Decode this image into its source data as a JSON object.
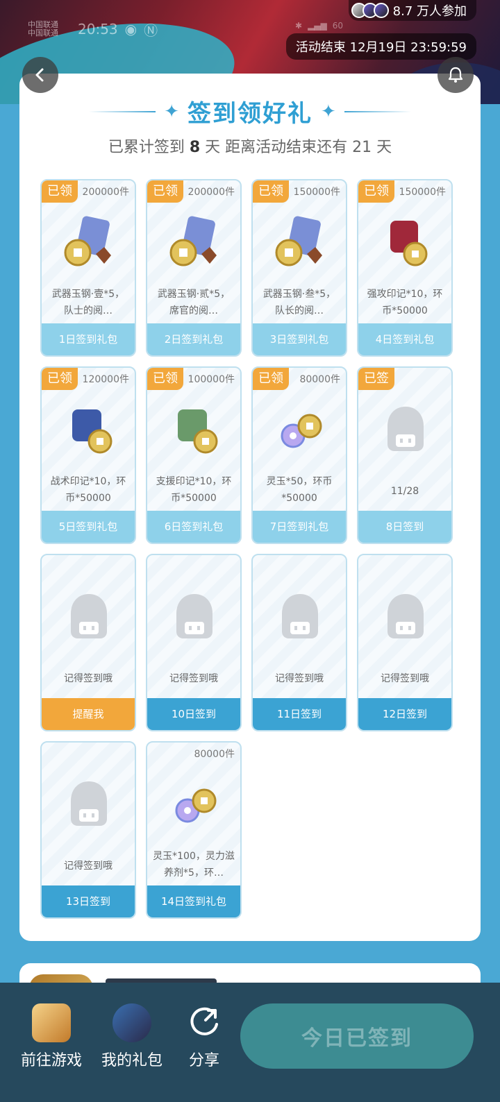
{
  "header": {
    "status_time": "20:53",
    "status_carrier_line1": "中国联通",
    "status_carrier_line2": "中国联通",
    "status_battery": "60",
    "participants_text": "8.7 万人参加",
    "end_time_text": "活动结束 12月19日 23:59:59"
  },
  "main": {
    "title": "签到领好礼",
    "subtitle_prefix": "已累计签到 ",
    "subtitle_days": "8",
    "subtitle_suffix": " 天  距离活动结束还有 21 天",
    "cells": [
      {
        "badge": "已领",
        "count": "200000件",
        "icon": "weapon-jade-steel-icon",
        "desc": "武器玉钢·壹*5，队士的阅…",
        "footer": "1日签到礼包"
      },
      {
        "badge": "已领",
        "count": "200000件",
        "icon": "weapon-jade-steel-icon",
        "desc": "武器玉钢·贰*5，席官的阅…",
        "footer": "2日签到礼包"
      },
      {
        "badge": "已领",
        "count": "150000件",
        "icon": "weapon-jade-steel-icon",
        "desc": "武器玉钢·叁*5，队长的阅…",
        "footer": "3日签到礼包"
      },
      {
        "badge": "已领",
        "count": "150000件",
        "icon": "attack-seal-icon",
        "desc": "强攻印记*10，环币*50000",
        "footer": "4日签到礼包"
      },
      {
        "badge": "已领",
        "count": "120000件",
        "icon": "tactic-seal-icon",
        "desc": "战术印记*10，环币*50000",
        "footer": "5日签到礼包"
      },
      {
        "badge": "已领",
        "count": "100000件",
        "icon": "support-seal-icon",
        "desc": "支援印记*10，环币*50000",
        "footer": "6日签到礼包"
      },
      {
        "badge": "已领",
        "count": "80000件",
        "icon": "spirit-jade-icon",
        "desc": "灵玉*50，环币*50000",
        "footer": "7日签到礼包"
      },
      {
        "badge": "已签",
        "count": "",
        "icon": "placeholder-avatar-icon",
        "desc": "11/28",
        "footer": "8日签到"
      },
      {
        "badge": "",
        "count": "",
        "icon": "placeholder-avatar-icon",
        "desc": "记得签到哦",
        "footer": "提醒我"
      },
      {
        "badge": "",
        "count": "",
        "icon": "placeholder-avatar-icon",
        "desc": "记得签到哦",
        "footer": "10日签到"
      },
      {
        "badge": "",
        "count": "",
        "icon": "placeholder-avatar-icon",
        "desc": "记得签到哦",
        "footer": "11日签到"
      },
      {
        "badge": "",
        "count": "",
        "icon": "placeholder-avatar-icon",
        "desc": "记得签到哦",
        "footer": "12日签到"
      },
      {
        "badge": "",
        "count": "",
        "icon": "placeholder-avatar-icon",
        "desc": "记得签到哦",
        "footer": "13日签到"
      },
      {
        "badge": "",
        "count": "80000件",
        "icon": "spirit-jade-icon",
        "desc": "灵玉*100，灵力滋养剂*5，环…",
        "footer": "14日签到礼包"
      }
    ]
  },
  "bottom": {
    "game_label": "前往游戏",
    "gift_label": "我的礼包",
    "share_label": "分享",
    "signed_label": "今日已签到"
  },
  "colors": {
    "accent": "#2f9fd3",
    "badge": "#f2a73b",
    "bottom_bar": "#26495d",
    "signed_btn": "#3d8c92"
  }
}
